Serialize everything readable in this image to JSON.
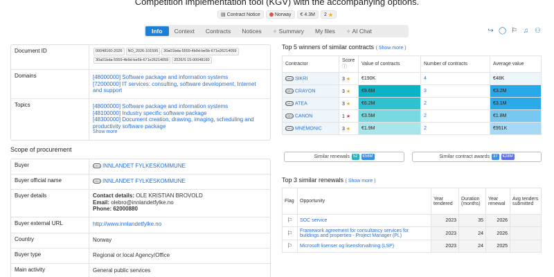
{
  "page": {
    "title": "Competition implementation tool (KGV) with the accompanying options.",
    "badges": {
      "notice_type": "Contract Notice",
      "country": "Norway",
      "value": "€ 4.3M",
      "score": "2"
    }
  },
  "tabs": [
    "Info",
    "Context",
    "Contracts",
    "Notices",
    "Summary",
    "My files",
    "AI Chat"
  ],
  "details": {
    "document_id_label": "Document ID",
    "document_ids": [
      "00048160-2026",
      "NO_2026-101595",
      "30a01bda-5559-4b9d-be5b-671e26214059",
      "30a01bda-5559-4b9d-be5b-671e26214059",
      "2026/S 15-00048160"
    ],
    "domains_label": "Domains",
    "domains": [
      "[48000000] Software package and information systems",
      "[72000000] IT services: consulting, software development, Internet and support"
    ],
    "topics_label": "Topics",
    "topics": [
      "[48000000] Software package and information systems",
      "[48100000] Industry specific software package",
      "[48300000] Document creation, drawing, imaging, scheduling and productivity software package"
    ],
    "show_more": "Show more"
  },
  "scope": {
    "title": "Scope of procurement",
    "buyer_label": "Buyer",
    "buyer": "INNLANDET FYLKESKOMMUNE",
    "buyer_official_label": "Buyer official name",
    "buyer_official": "INNLANDET FYLKESKOMMUNE",
    "buyer_details_label": "Buyer details",
    "contact_label": "Contact details:",
    "contact": "OLE KRISTIAN BROVOLD",
    "email_label": "Email:",
    "email": "olebro@innlandetfylke.no",
    "phone_label": "Phone:",
    "phone": "62000880",
    "url_label": "Buyer external URL",
    "url": "http://www.innlandetfylke.no",
    "country_label": "Country",
    "country": "Norway",
    "buyer_type_label": "Buyer type",
    "buyer_type": "Regional or local Agency/Office",
    "main_activity_label": "Main activity",
    "main_activity": "General public services"
  },
  "winners": {
    "title": "Top 5 winners of similar contracts",
    "show_more": "( Show more )",
    "headers": [
      "Contractor",
      "Score",
      "Value of contracts",
      "Number of contracts",
      "Average value"
    ],
    "rows": [
      {
        "name": "SIKRI",
        "score": "3",
        "value": "€190K",
        "count": "4",
        "avg": "€48K",
        "value_bg": "#ffffff",
        "count_bg": "#ffffff",
        "avg_bg": "#ecf6fd"
      },
      {
        "name": "CRAYON",
        "score": "3",
        "value": "€9.6M",
        "count": "3",
        "avg": "€3.2M",
        "value_bg": "#0ab3c6",
        "count_bg": "#ffffff",
        "avg_bg": "#27a8e8"
      },
      {
        "name": "ATEA",
        "score": "3",
        "value": "€6.2M",
        "count": "2",
        "avg": "€3.1M",
        "value_bg": "#30c1d0",
        "count_bg": "#ffffff",
        "avg_bg": "#2aaae8"
      },
      {
        "name": "CANON",
        "score": "1",
        "value": "€3.5M",
        "count": "2",
        "avg": "€1.8M",
        "value_bg": "#78d8e0",
        "count_bg": "#ffffff",
        "avg_bg": "#77c8f0"
      },
      {
        "name": "MNEMONIC",
        "score": "3",
        "value": "€1.9M",
        "count": "2",
        "avg": "€951K",
        "value_bg": "#a8e6ec",
        "count_bg": "#ffffff",
        "avg_bg": "#a4daf5"
      }
    ]
  },
  "similar": {
    "renewals_label": "Similar renewals",
    "renewals_count": "52",
    "renewals_value": "€56M",
    "awards_label": "Similar contract awards",
    "awards_count": "37",
    "awards_value": "€28M"
  },
  "renewals": {
    "title": "Top 3 similar renewals",
    "show_more": "( Show more )",
    "headers": [
      "Flag",
      "Opportunity",
      "Year tendered",
      "Duration (months)",
      "Year renewal",
      "Avg tenders submitted"
    ],
    "rows": [
      {
        "opportunity": "SOC service",
        "year": "2023",
        "duration": "35",
        "renewal": "2026"
      },
      {
        "opportunity": "Framework agreement for consultancy services for buildings and properties - Project Manager (PL)",
        "year": "2023",
        "duration": "24",
        "renewal": "2026"
      },
      {
        "opportunity": "Microsoft lisenser og lisensforvaltning (LSP)",
        "year": "2023",
        "duration": "24",
        "renewal": "2025"
      }
    ]
  }
}
